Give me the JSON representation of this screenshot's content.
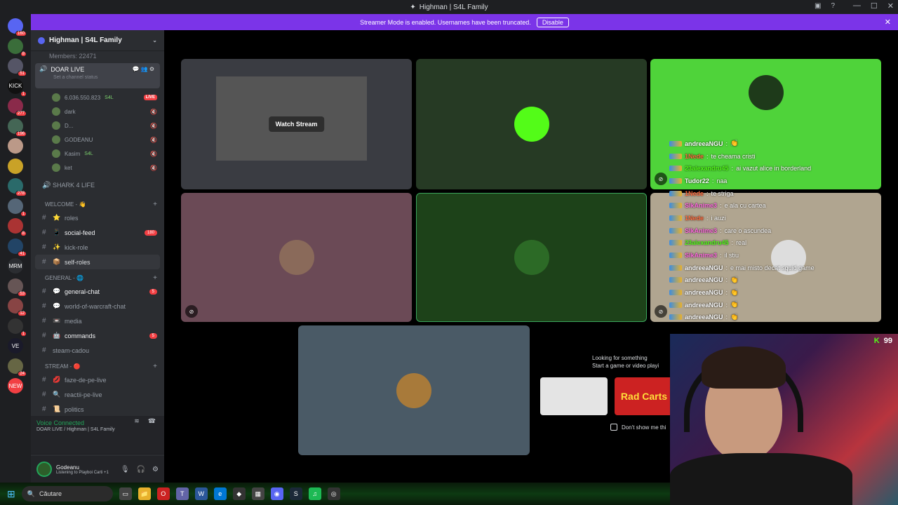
{
  "window": {
    "title": "Highman | S4L Family",
    "buttons": [
      "—",
      "☐",
      "✕"
    ]
  },
  "banner": {
    "text": "Streamer Mode is enabled. Usernames have been truncated.",
    "button": "Disable"
  },
  "servers": [
    {
      "label": "",
      "count": "160",
      "color": "#5865f2"
    },
    {
      "label": "",
      "count": "8",
      "color": "#3a6d3a"
    },
    {
      "label": "",
      "count": "51",
      "color": "#556"
    },
    {
      "label": "KICK",
      "count": "1",
      "color": "#111"
    },
    {
      "label": "",
      "count": "277",
      "color": "#8a2a4a"
    },
    {
      "label": "",
      "count": "196",
      "color": "#465"
    },
    {
      "label": "",
      "count": "",
      "color": "#b98"
    },
    {
      "label": "",
      "count": "",
      "color": "#c9a227"
    },
    {
      "label": "",
      "count": "278",
      "color": "#2a6a6a"
    },
    {
      "label": "",
      "count": "1",
      "color": "#567"
    },
    {
      "label": "",
      "count": "8",
      "color": "#a33"
    },
    {
      "label": "",
      "count": "41",
      "color": "#246"
    },
    {
      "label": "MRM",
      "count": "",
      "color": "#2b2d31"
    },
    {
      "label": "",
      "count": "53",
      "color": "#655"
    },
    {
      "label": "",
      "count": "12",
      "color": "#844"
    },
    {
      "label": "",
      "count": "1",
      "color": "#333"
    },
    {
      "label": "VE",
      "count": "",
      "color": "#1a1a2a"
    },
    {
      "label": "",
      "count": "24",
      "color": "#664"
    },
    {
      "label": "NEW",
      "count": "",
      "color": "#f23f43"
    }
  ],
  "guild": {
    "name": "Highman | S4L Family",
    "members": "Members: 22471"
  },
  "voice": {
    "channel": "DOAR LIVE",
    "status": "Set a channel status",
    "users": [
      {
        "name": "6.036.550.823",
        "tag": "S4L",
        "live": "LIVE"
      },
      {
        "name": "dark",
        "tag": "",
        "live": ""
      },
      {
        "name": "D...",
        "tag": "",
        "live": ""
      },
      {
        "name": "GODEANU",
        "tag": "",
        "live": ""
      },
      {
        "name": "Kasim",
        "tag": "S4L",
        "live": ""
      },
      {
        "name": "ket",
        "tag": "",
        "live": ""
      }
    ],
    "other_channel": "SHARK 4 LIFE"
  },
  "categories": {
    "welcome": "WELCOME - 👋",
    "general": "GENERAL - 🌐",
    "stream": "STREAM - 🔴"
  },
  "channels_welcome": [
    {
      "emoji": "⭐",
      "name": "roles",
      "badge": ""
    },
    {
      "emoji": "📱",
      "name": "social-feed",
      "badge": "180"
    },
    {
      "emoji": "✨",
      "name": "kick-role",
      "badge": ""
    },
    {
      "emoji": "📦",
      "name": "self-roles",
      "badge": ""
    }
  ],
  "channels_general": [
    {
      "emoji": "💬",
      "name": "general-chat",
      "badge": "5"
    },
    {
      "emoji": "💬",
      "name": "world-of-warcraft-chat",
      "badge": ""
    },
    {
      "emoji": "📼",
      "name": "media",
      "badge": ""
    },
    {
      "emoji": "🤖",
      "name": "commands",
      "badge": "5"
    },
    {
      "emoji": "",
      "name": "steam-cadou",
      "badge": ""
    }
  ],
  "channels_stream": [
    {
      "emoji": "💋",
      "name": "faze-de-pe-live",
      "badge": ""
    },
    {
      "emoji": "🔍",
      "name": "reactii-pe-live",
      "badge": ""
    },
    {
      "emoji": "📜",
      "name": "politics",
      "badge": ""
    }
  ],
  "voice_connected": {
    "title": "Voice Connected",
    "sub": "DOAR LIVE / Highman | S4L Family"
  },
  "user": {
    "name": "Godeanu",
    "activity": "Listening to Playboi Carti +1"
  },
  "stage": {
    "watch": "Watch Stream"
  },
  "chat": [
    {
      "user": "andreeaNGU",
      "msg": "👏",
      "color": "#ffffff"
    },
    {
      "user": "1Nede",
      "msg": "te cheama cristi",
      "color": "#ff6a3d"
    },
    {
      "user": "23alexandru45",
      "msg": "ai vazut alice in borderland",
      "color": "#53fc18"
    },
    {
      "user": "Tudor22",
      "msg": "naa",
      "color": "#ffffff"
    },
    {
      "user": "1Nede",
      "msg": "te striga",
      "color": "#ff6a3d"
    },
    {
      "user": "SlkAnime3",
      "msg": "e ala cu cartea",
      "color": "#ff6adf"
    },
    {
      "user": "1Nede",
      "msg": "i auzi",
      "color": "#ff6a3d"
    },
    {
      "user": "SlkAnime3",
      "msg": "care o ascundea",
      "color": "#ff6adf"
    },
    {
      "user": "23alexandru45",
      "msg": "real",
      "color": "#53fc18"
    },
    {
      "user": "SlkAnime3",
      "msg": "il stiu",
      "color": "#ff6adf"
    },
    {
      "user": "andreeaNGU",
      "msg": "e mai misto decat squid game",
      "color": "#ffffff"
    },
    {
      "user": "andreeaNGU",
      "msg": "👏",
      "color": "#ffffff"
    },
    {
      "user": "andreeaNGU",
      "msg": "👏",
      "color": "#ffffff"
    },
    {
      "user": "andreeaNGU",
      "msg": "👏",
      "color": "#ffffff"
    },
    {
      "user": "andreeaNGU",
      "msg": "👏",
      "color": "#ffffff"
    }
  ],
  "promo": {
    "line1": "Looking for something",
    "line2": "Start a game or video playi",
    "game": "Rad Carts",
    "checkbox": "Don't show me thi"
  },
  "kick_viewers": "99",
  "taskbar": {
    "search": "Căutare"
  }
}
